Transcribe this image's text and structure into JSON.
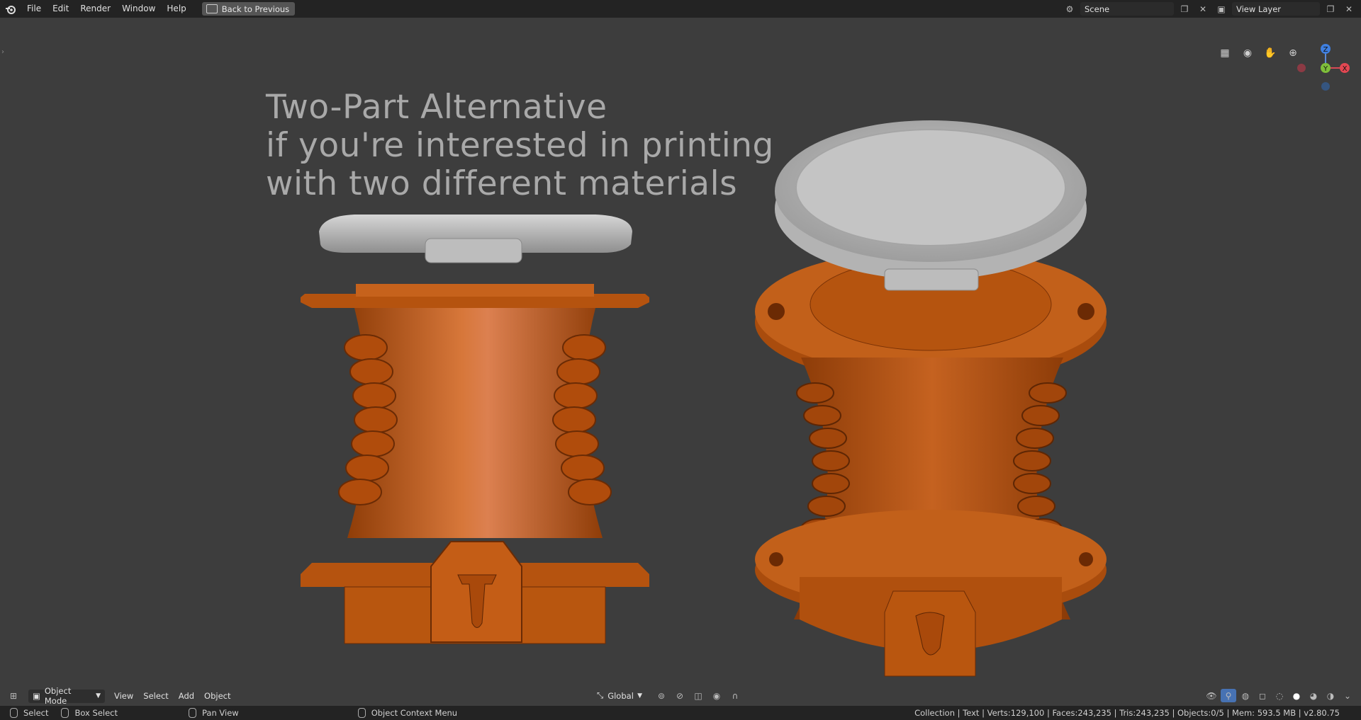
{
  "topbar": {
    "menu": [
      "File",
      "Edit",
      "Render",
      "Window",
      "Help"
    ],
    "back_button": "Back to Previous",
    "scene": "Scene",
    "view_layer": "View Layer"
  },
  "viewport": {
    "headline": [
      "Two-Part Alternative",
      "if you're interested in printing",
      "with two different materials"
    ],
    "gizmo": {
      "z": "Z",
      "y": "Y",
      "x": "X"
    }
  },
  "header": {
    "mode": "Object Mode",
    "menus": [
      "View",
      "Select",
      "Add",
      "Object"
    ],
    "transform_orientation": "Global"
  },
  "status": {
    "select": "Select",
    "box_select": "Box Select",
    "pan_view": "Pan View",
    "context_menu": "Object Context Menu",
    "stats": "Collection | Text | Verts:129,100 | Faces:243,235 | Tris:243,235 | Objects:0/5 | Mem: 593.5 MB | v2.80.75"
  },
  "colors": {
    "orange": "#c35a12",
    "lid": "#b9b9b9",
    "bg": "#3d3d3d"
  }
}
